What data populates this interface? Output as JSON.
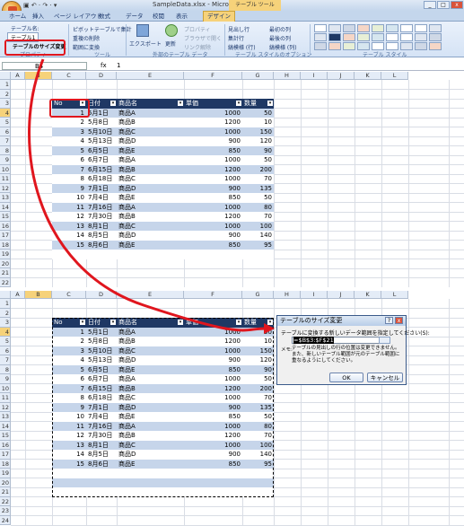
{
  "window": {
    "title": "SampleData.xlsx - Microsoft Excel",
    "context_tab": "テーブル ツール",
    "min": "_",
    "max": "□",
    "close": "x"
  },
  "qat": {
    "items": "▣ ↶ · ↷ · ▾"
  },
  "tabs": [
    "ホーム",
    "挿入",
    "ページ レイアウト",
    "数式",
    "データ",
    "校閲",
    "表示",
    "デザイン"
  ],
  "tab_active_index": 7,
  "ribbon": {
    "props": {
      "table_name_label": "テーブル名:",
      "table_name_value": "テーブル1",
      "resize": "テーブルのサイズ変更",
      "group": "プロパティ"
    },
    "tools": {
      "pivot": "ピボットテーブルで集計",
      "remove_dup": "重複の削除",
      "convert": "範囲に変換",
      "group": "ツール"
    },
    "external": {
      "export": "エクスポート",
      "refresh": "更新",
      "props": "プロパティ",
      "open_browser": "ブラウザで開く",
      "unlink": "リンク解除",
      "group": "外部のテーブル データ"
    },
    "style_options": {
      "header_row": "見出し行",
      "total_row": "集計行",
      "banded_rows": "縞模様 (行)",
      "first_col": "最初の列",
      "last_col": "最後の列",
      "banded_cols": "縞模様 (列)",
      "group": "テーブル スタイルのオプション"
    },
    "styles": {
      "group": "テーブル スタイル"
    }
  },
  "formula_bar": {
    "name_box": "B4",
    "fx": "fx",
    "value": "1"
  },
  "columns": [
    "A",
    "B",
    "C",
    "D",
    "E",
    "F",
    "G",
    "H",
    "I",
    "J",
    "K",
    "L"
  ],
  "table": {
    "headers": [
      "No",
      "日付",
      "商品名",
      "単価",
      "数量"
    ],
    "rows": [
      [
        "1",
        "5月1日",
        "商品A",
        "1000",
        "50"
      ],
      [
        "2",
        "5月8日",
        "商品B",
        "1200",
        "10"
      ],
      [
        "3",
        "5月10日",
        "商品C",
        "1000",
        "150"
      ],
      [
        "4",
        "5月13日",
        "商品D",
        "900",
        "120"
      ],
      [
        "5",
        "6月5日",
        "商品E",
        "850",
        "90"
      ],
      [
        "6",
        "6月7日",
        "商品A",
        "1000",
        "50"
      ],
      [
        "7",
        "6月15日",
        "商品B",
        "1200",
        "200"
      ],
      [
        "8",
        "6月18日",
        "商品C",
        "1000",
        "70"
      ],
      [
        "9",
        "7月1日",
        "商品D",
        "900",
        "135"
      ],
      [
        "10",
        "7月4日",
        "商品E",
        "850",
        "50"
      ],
      [
        "11",
        "7月16日",
        "商品A",
        "1000",
        "80"
      ],
      [
        "12",
        "7月30日",
        "商品B",
        "1200",
        "70"
      ],
      [
        "13",
        "8月1日",
        "商品C",
        "1000",
        "100"
      ],
      [
        "14",
        "8月5日",
        "商品D",
        "900",
        "140"
      ],
      [
        "15",
        "8月6日",
        "商品E",
        "850",
        "95"
      ]
    ]
  },
  "top_rows": [
    "1",
    "2",
    "3",
    "4",
    "5",
    "6",
    "7",
    "8",
    "9",
    "10",
    "11",
    "12",
    "13",
    "14",
    "15",
    "16",
    "17",
    "18",
    "19",
    "20",
    "21",
    "22"
  ],
  "bottom_rows": [
    "1",
    "2",
    "3",
    "4",
    "5",
    "6",
    "7",
    "8",
    "9",
    "10",
    "11",
    "12",
    "13",
    "14",
    "15",
    "16",
    "17",
    "18",
    "19",
    "20",
    "21",
    "22",
    "23",
    "24"
  ],
  "dialog": {
    "title": "テーブルのサイズ変更",
    "help": "?",
    "close": "x",
    "prompt": "テーブルに変換する新しいデータ範囲を指定してください(S):",
    "range": "=$B$3:$F$21",
    "memo_label": "メモ:",
    "note": "テーブルの見出しの行の位置は変更できません。また、新しいテーブル範囲が元のテーブル範囲に重なるようにしてください。",
    "ok": "OK",
    "cancel": "キャンセル"
  },
  "colors": {
    "header_fill": "#1f3864",
    "band_fill": "#c6d5ea",
    "highlight": "#e0161e",
    "active_tab": "#f6d27a"
  }
}
